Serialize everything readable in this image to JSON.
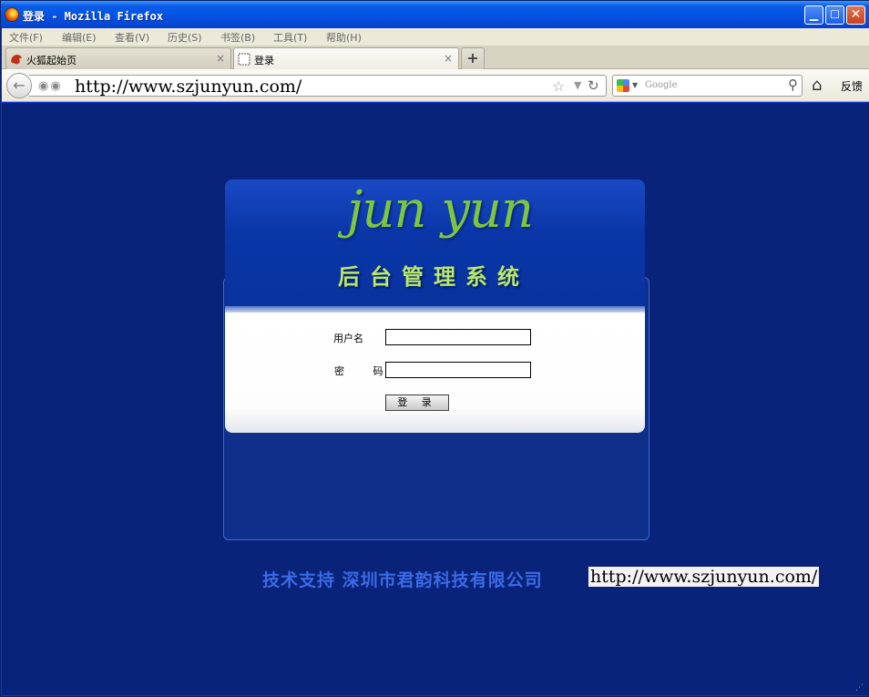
{
  "window": {
    "title": "登录 - Mozilla Firefox",
    "buttons": {
      "minimize": "▁",
      "maximize": "☐",
      "close": "✕"
    }
  },
  "menu": {
    "items": [
      "文件(F)",
      "编辑(E)",
      "查看(V)",
      "历史(S)",
      "书签(B)",
      "工具(T)",
      "帮助(H)"
    ]
  },
  "tabs": [
    {
      "label": "火狐起始页",
      "icon": "firefox-fox-icon",
      "close": "×"
    },
    {
      "label": "登录",
      "icon": "blank-page-icon",
      "close": "×"
    }
  ],
  "new_tab_label": "+",
  "navbar": {
    "url": "http://www.szjunyun.com/",
    "search_placeholder": "Google",
    "feedback_label": "反馈"
  },
  "login": {
    "brand": "jun yun",
    "system_title": "后台管理系统",
    "username_label": "用户名",
    "password_label": "密 码",
    "username_value": "",
    "password_value": "",
    "submit_label": "登 录"
  },
  "footer": {
    "company": "技术支持  深圳市君韵科技有限公司",
    "url": "http://www.szjunyun.com/"
  },
  "colors": {
    "page_background": "#0a237a",
    "brand_green": "#7dc63f",
    "title_green": "#b9e86c",
    "footer_blue": "#3b6ae6"
  }
}
